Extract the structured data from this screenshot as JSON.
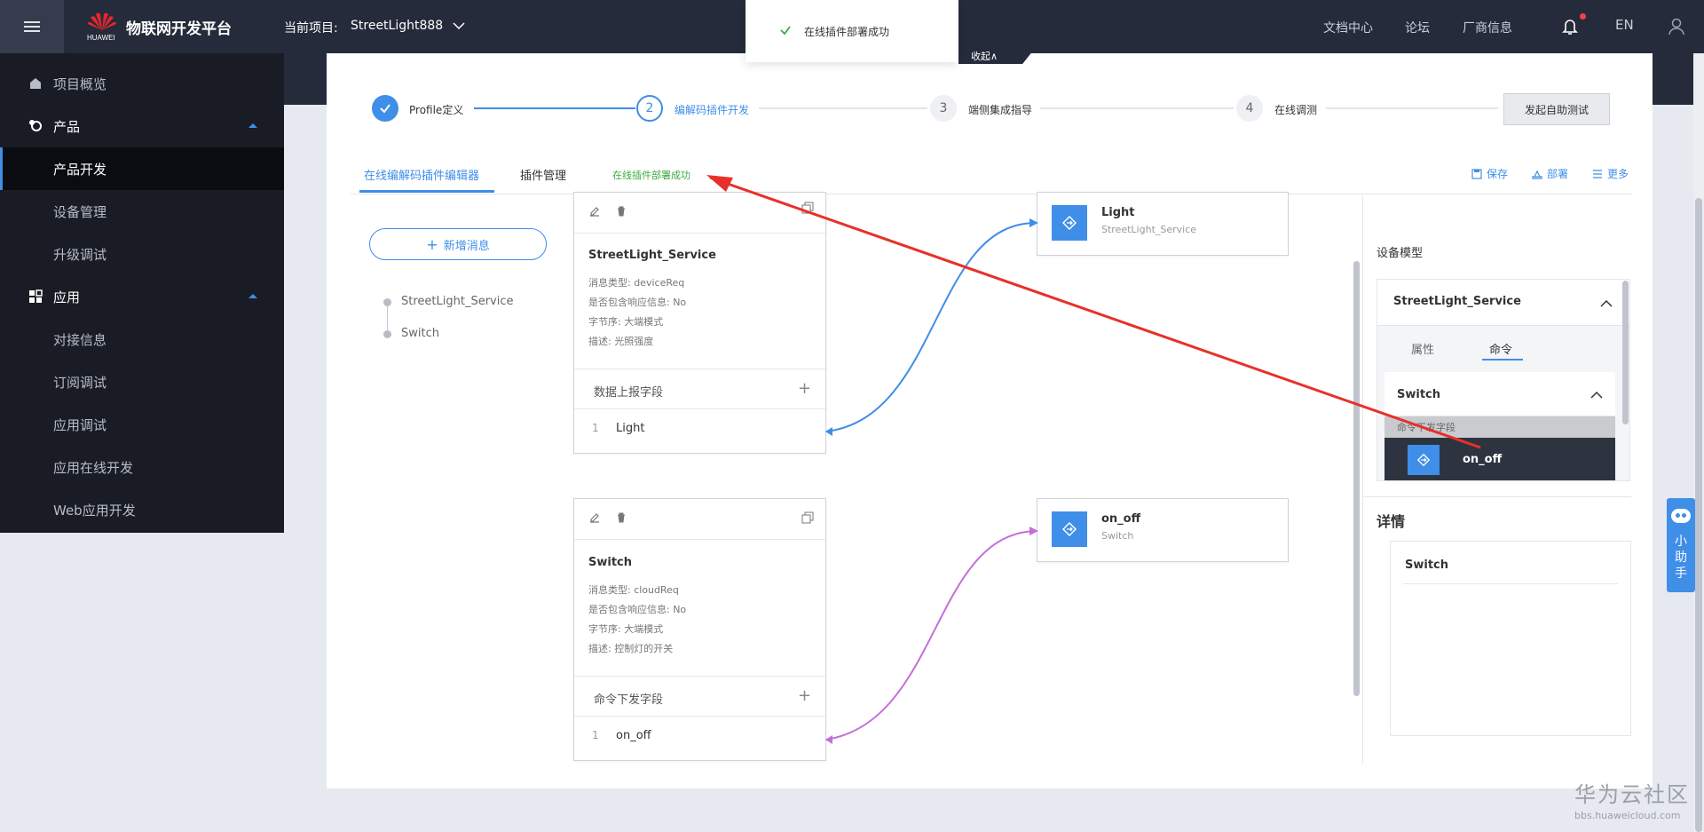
{
  "header": {
    "brand_word": "HUAWEI",
    "platform_name": "物联网开发平台",
    "project_label": "当前项目:",
    "project_name": "StreetLight888",
    "links": [
      "文档中心",
      "论坛",
      "厂商信息"
    ],
    "language": "EN"
  },
  "toast": {
    "message": "在线插件部署成功"
  },
  "collapse_label": "收起∧",
  "sidebar": {
    "items": [
      {
        "label": "项目概览"
      },
      {
        "label": "产品"
      },
      {
        "label": "产品开发"
      },
      {
        "label": "设备管理"
      },
      {
        "label": "升级调试"
      },
      {
        "label": "应用"
      },
      {
        "label": "对接信息"
      },
      {
        "label": "订阅调试"
      },
      {
        "label": "应用调试"
      },
      {
        "label": "应用在线开发"
      },
      {
        "label": "Web应用开发"
      }
    ]
  },
  "steps": [
    {
      "num": "1",
      "label": "Profile定义",
      "state": "done"
    },
    {
      "num": "2",
      "label": "编解码插件开发",
      "state": "active"
    },
    {
      "num": "3",
      "label": "端侧集成指导",
      "state": "todo"
    },
    {
      "num": "4",
      "label": "在线调测",
      "state": "todo"
    }
  ],
  "auto_test_button": "发起自助测试",
  "tabs": {
    "editor": "在线编解码插件编辑器",
    "manage": "插件管理",
    "status": "在线插件部署成功"
  },
  "actions": {
    "save": "保存",
    "deploy": "部署",
    "more": "更多"
  },
  "add_message_button": "新增消息",
  "message_tree": [
    "StreetLight_Service",
    "Switch"
  ],
  "messages": [
    {
      "name": "StreetLight_Service",
      "type_line": "消息类型: deviceReq",
      "response_line": "是否包含响应信息: No",
      "byte_order_line": "字节序: 大端模式",
      "desc_line": "描述: 光照强度",
      "section": "数据上报字段",
      "field_num": "1",
      "field_name": "Light"
    },
    {
      "name": "Switch",
      "type_line": "消息类型: cloudReq",
      "response_line": "是否包含响应信息: No",
      "byte_order_line": "字节序: 大端模式",
      "desc_line": "描述: 控制灯的开关",
      "section": "命令下发字段",
      "field_num": "1",
      "field_name": "on_off"
    }
  ],
  "targets": [
    {
      "name": "Light",
      "service": "StreetLight_Service"
    },
    {
      "name": "on_off",
      "service": "Switch"
    }
  ],
  "device_model": {
    "title": "设备模型",
    "service": "StreetLight_Service",
    "tab_attributes": "属性",
    "tab_commands": "命令",
    "command": "Switch",
    "fields_label": "命令下发字段",
    "field": "on_off"
  },
  "detail": {
    "title": "详情",
    "name": "Switch"
  },
  "assistant_label": "小助手",
  "watermark": {
    "title": "华为云社区",
    "url": "bbs.huaweicloud.com"
  },
  "colors": {
    "accent": "#3f8ee8",
    "success": "#3cab3c",
    "annotation": "#e8302a",
    "link_purple": "#c46fd9"
  }
}
